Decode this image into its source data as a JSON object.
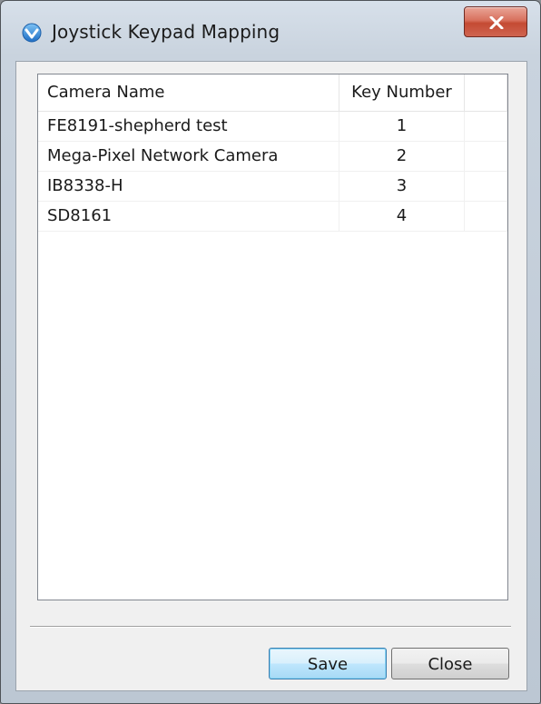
{
  "window": {
    "title": "Joystick Keypad Mapping",
    "app_icon": "vivotek-shield-icon",
    "close_icon": "close-icon"
  },
  "table": {
    "columns": [
      "Camera Name",
      "Key Number",
      ""
    ],
    "rows": [
      {
        "camera_name": "FE8191-shepherd test",
        "key_number": "1"
      },
      {
        "camera_name": "Mega-Pixel Network Camera",
        "key_number": "2"
      },
      {
        "camera_name": "IB8338-H",
        "key_number": "3"
      },
      {
        "camera_name": "SD8161",
        "key_number": "4"
      }
    ]
  },
  "buttons": {
    "save_label": "Save",
    "close_label": "Close"
  },
  "colors": {
    "close_button": "#c44a33",
    "default_button_border": "#3c7fb1",
    "app_icon_blue": "#2f7fd0"
  }
}
